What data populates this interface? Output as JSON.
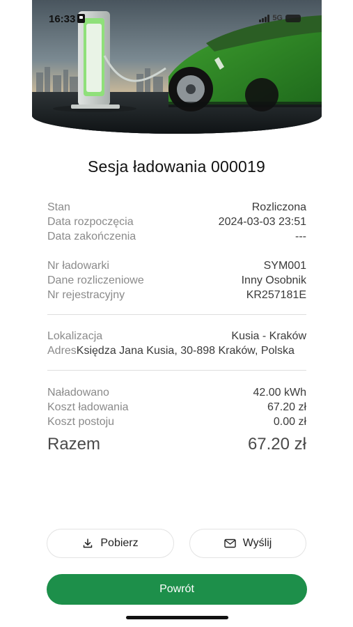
{
  "status_bar": {
    "time": "16:33",
    "network": "5G"
  },
  "session": {
    "title": "Sesja ładowania 000019"
  },
  "details_group_1": [
    {
      "label": "Stan",
      "value": "Rozliczona"
    },
    {
      "label": "Data rozpoczęcia",
      "value": "2024-03-03 23:51"
    },
    {
      "label": "Data zakończenia",
      "value": "---"
    }
  ],
  "details_group_2": [
    {
      "label": "Nr ładowarki",
      "value": "SYM001"
    },
    {
      "label": "Dane rozliczeniowe",
      "value": "Inny Osobnik"
    },
    {
      "label": "Nr rejestracyjny",
      "value": "KR257181E"
    }
  ],
  "location": {
    "label": "Lokalizacja",
    "value": "Kusia - Kraków",
    "address_label": "Adres",
    "address_value": "Księdza Jana Kusia, 30-898 Kraków, Polska"
  },
  "costs": [
    {
      "label": "Naładowano",
      "value": "42.00 kWh"
    },
    {
      "label": "Koszt ładowania",
      "value": "67.20 zł"
    },
    {
      "label": "Koszt postoju",
      "value": "0.00 zł"
    }
  ],
  "total": {
    "label": "Razem",
    "value": "67.20 zł"
  },
  "actions": {
    "download_label": "Pobierz",
    "send_label": "Wyślij",
    "back_label": "Powrót"
  },
  "colors": {
    "primary": "#1d8f4a",
    "label": "#8a8a8a",
    "value": "#3a3a3a",
    "divider": "#dedede"
  }
}
